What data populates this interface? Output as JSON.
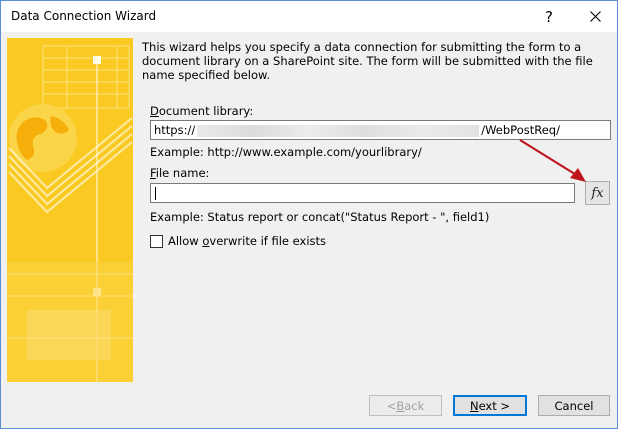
{
  "window": {
    "title": "Data Connection Wizard",
    "help_glyph": "?"
  },
  "intro_text": "This wizard helps you specify a data connection for submitting the form to a document library on a SharePoint site. The form will be submitted with the file name specified below.",
  "document_library": {
    "label_accel": "D",
    "label_rest": "ocument library:",
    "value_prefix": "https://",
    "value_suffix": "/WebPostReq/",
    "example": "Example: http://www.example.com/yourlibrary/"
  },
  "file_name": {
    "label_accel": "F",
    "label_rest": "ile name:",
    "value": "",
    "example": "Example: Status report or concat(\"Status Report - \", field1)",
    "fx_label": "fx"
  },
  "overwrite": {
    "label_before": "Allow ",
    "label_accel": "o",
    "label_after": "verwrite if file exists",
    "checked": false
  },
  "buttons": {
    "back": {
      "before": "< ",
      "accel": "B",
      "after": "ack",
      "enabled": false
    },
    "next": {
      "accel": "N",
      "after": "ext >"
    },
    "cancel": {
      "label": "Cancel"
    }
  },
  "colors": {
    "banner_base": "#f8c20c",
    "banner_light": "#fbd848",
    "annotation_arrow": "#c0141c",
    "default_button_border": "#0078d7"
  }
}
